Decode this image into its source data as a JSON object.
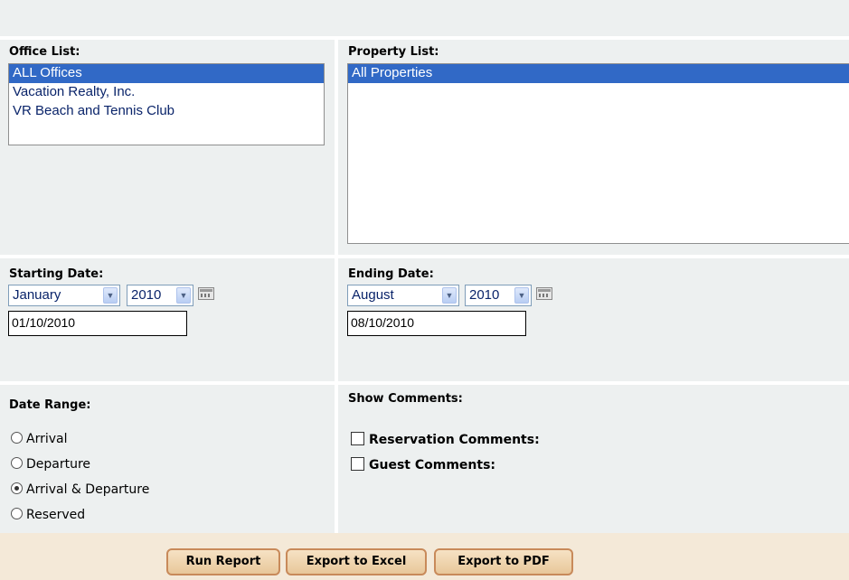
{
  "office": {
    "label": "Office List:",
    "options": [
      "ALL Offices",
      "Vacation Realty, Inc.",
      "VR Beach and Tennis Club"
    ],
    "selected_index": 0
  },
  "property": {
    "label": "Property List:",
    "options": [
      "All Properties"
    ],
    "selected_index": 0
  },
  "start": {
    "label": "Starting Date:",
    "month": "January",
    "year": "2010",
    "date": "01/10/2010"
  },
  "end": {
    "label": "Ending Date:",
    "month": "August",
    "year": "2010",
    "date": "08/10/2010"
  },
  "date_range": {
    "label": "Date Range:",
    "options": [
      "Arrival",
      "Departure",
      "Arrival & Departure",
      "Reserved"
    ],
    "selected": "Arrival & Departure"
  },
  "comments": {
    "label": "Show Comments:",
    "options": [
      "Reservation Comments:",
      "Guest Comments:"
    ]
  },
  "buttons": {
    "run": "Run Report",
    "excel": "Export to Excel",
    "pdf": "Export to PDF"
  },
  "colors": {
    "panel_bg": "#edf0f0",
    "selection": "#3169c6",
    "footer_bg": "#f4e9d8",
    "button_border": "#c88a5a"
  }
}
